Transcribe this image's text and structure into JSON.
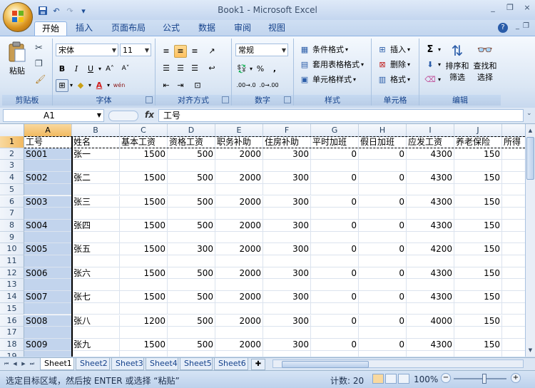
{
  "window": {
    "title": "Book1 - Microsoft Excel",
    "controls": [
      "_",
      "❐",
      "×"
    ]
  },
  "qat": {
    "save": "💾",
    "undo": "↶",
    "redo": "↷",
    "customize": "▾"
  },
  "tabs": [
    "开始",
    "插入",
    "页面布局",
    "公式",
    "数据",
    "审阅",
    "视图"
  ],
  "ribbon": {
    "clipboard": {
      "label": "剪贴板",
      "paste": "粘贴"
    },
    "font": {
      "label": "字体",
      "font_name": "宋体",
      "font_size": "11",
      "bold": "B",
      "italic": "I",
      "underline": "U",
      "grow": "A˄",
      "shrink": "A˅",
      "wen": "wén",
      "font_color_letter": "A"
    },
    "alignment": {
      "label": "对齐方式"
    },
    "number": {
      "label": "数字",
      "format": "常规",
      "percent": "%",
      "comma": ",",
      "inc_dec": ".00→.0",
      "dec_dec": ".0→.00"
    },
    "styles": {
      "label": "样式",
      "conditional": "条件格式",
      "table": "套用表格格式",
      "cell_styles": "单元格样式"
    },
    "cells": {
      "label": "单元格",
      "insert": "插入",
      "delete": "删除",
      "format": "格式"
    },
    "editing": {
      "label": "编辑",
      "sort_filter_1": "排序和",
      "sort_filter_2": "筛选",
      "find_1": "查找和",
      "find_2": "选择",
      "sigma": "Σ"
    }
  },
  "formula_bar": {
    "name_box": "A1",
    "fx": "fx",
    "content": "工号"
  },
  "columns": [
    "A",
    "B",
    "C",
    "D",
    "E",
    "F",
    "G",
    "H",
    "I",
    "J"
  ],
  "rows": [
    {
      "n": "1",
      "cells": [
        "工号",
        "姓名",
        "基本工资",
        "资格工资",
        "职务补助",
        "住房补助",
        "平时加班",
        "假日加班",
        "应发工资",
        "养老保险",
        "所得"
      ]
    },
    {
      "n": "2",
      "cells": [
        "S001",
        "张一",
        "1500",
        "500",
        "2000",
        "300",
        "0",
        "0",
        "4300",
        "150"
      ]
    },
    {
      "n": "3",
      "cells": []
    },
    {
      "n": "4",
      "cells": [
        "S002",
        "张二",
        "1500",
        "500",
        "2000",
        "300",
        "0",
        "0",
        "4300",
        "150"
      ]
    },
    {
      "n": "5",
      "cells": []
    },
    {
      "n": "6",
      "cells": [
        "S003",
        "张三",
        "1500",
        "500",
        "2000",
        "300",
        "0",
        "0",
        "4300",
        "150"
      ]
    },
    {
      "n": "7",
      "cells": []
    },
    {
      "n": "8",
      "cells": [
        "S004",
        "张四",
        "1500",
        "500",
        "2000",
        "300",
        "0",
        "0",
        "4300",
        "150"
      ]
    },
    {
      "n": "9",
      "cells": []
    },
    {
      "n": "10",
      "cells": [
        "S005",
        "张五",
        "1500",
        "300",
        "2000",
        "300",
        "0",
        "0",
        "4200",
        "150"
      ]
    },
    {
      "n": "11",
      "cells": []
    },
    {
      "n": "12",
      "cells": [
        "S006",
        "张六",
        "1500",
        "500",
        "2000",
        "300",
        "0",
        "0",
        "4300",
        "150"
      ]
    },
    {
      "n": "13",
      "cells": []
    },
    {
      "n": "14",
      "cells": [
        "S007",
        "张七",
        "1500",
        "500",
        "2000",
        "300",
        "0",
        "0",
        "4300",
        "150"
      ]
    },
    {
      "n": "15",
      "cells": []
    },
    {
      "n": "16",
      "cells": [
        "S008",
        "张八",
        "1200",
        "500",
        "2000",
        "300",
        "0",
        "0",
        "4000",
        "150"
      ]
    },
    {
      "n": "17",
      "cells": []
    },
    {
      "n": "18",
      "cells": [
        "S009",
        "张九",
        "1500",
        "500",
        "2000",
        "300",
        "0",
        "0",
        "4300",
        "150"
      ]
    },
    {
      "n": "19",
      "cells": []
    }
  ],
  "sheets": [
    "Sheet1",
    "Sheet2",
    "Sheet3",
    "Sheet4",
    "Sheet5",
    "Sheet6"
  ],
  "status": {
    "message": "选定目标区域，然后按 ENTER 或选择 “粘贴”",
    "count": "计数: 20",
    "zoom": "100%",
    "minus": "−",
    "plus": "+"
  }
}
